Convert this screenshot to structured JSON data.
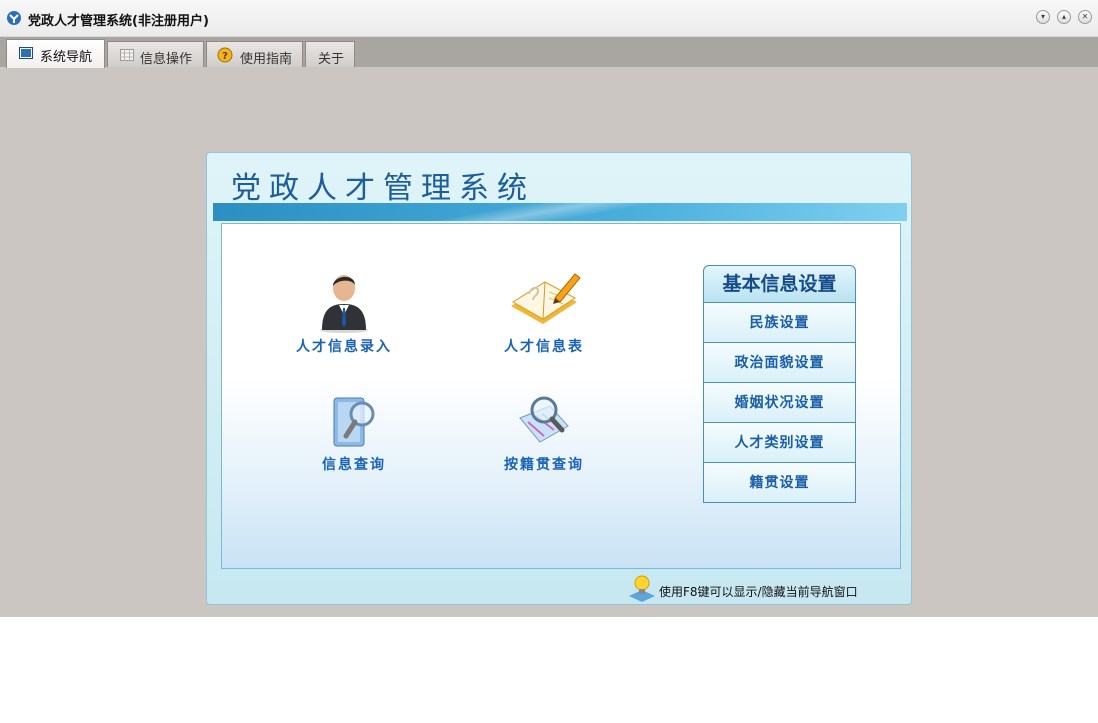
{
  "window": {
    "title": "党政人才管理系统(非注册用户)"
  },
  "tabs": [
    {
      "label": "系统导航",
      "active": true,
      "icon": "monitor-icon"
    },
    {
      "label": "信息操作",
      "active": false,
      "icon": "grid-icon"
    },
    {
      "label": "使用指南",
      "active": false,
      "icon": "help-icon"
    },
    {
      "label": "关于",
      "active": false
    }
  ],
  "panel": {
    "title": "党政人才管理系统",
    "nav_items": [
      {
        "label": "人才信息录入",
        "icon": "person-icon"
      },
      {
        "label": "人才信息表",
        "icon": "notebook-pencil-icon"
      },
      {
        "label": "信息查询",
        "icon": "document-search-icon"
      },
      {
        "label": "按籍贯查询",
        "icon": "map-search-icon"
      }
    ],
    "settings": {
      "header": "基本信息设置",
      "items": [
        "民族设置",
        "政治面貌设置",
        "婚姻状况设置",
        "人才类别设置",
        "籍贯设置"
      ]
    },
    "hint": "使用F8键可以显示/隐藏当前导航窗口"
  },
  "colors": {
    "accent": "#1a63b5",
    "banner": "#2b8fc2",
    "window_bg": "#cbc6c2"
  }
}
